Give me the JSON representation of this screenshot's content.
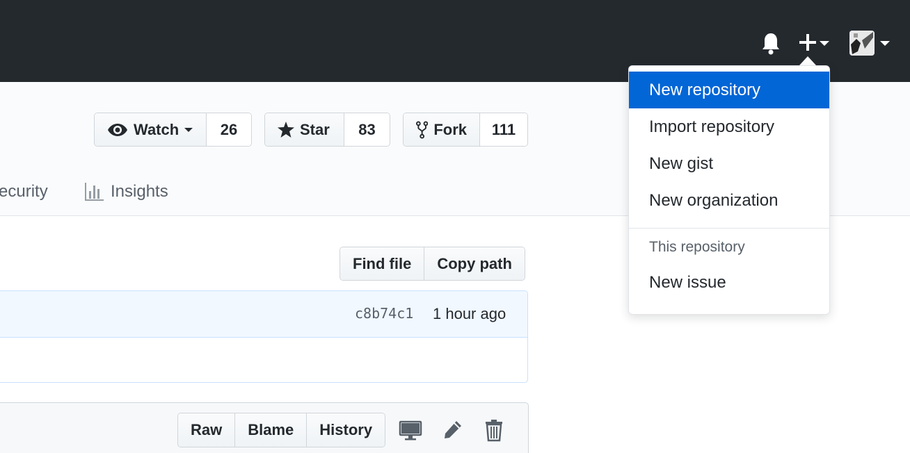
{
  "header": {
    "icons": [
      "bell-icon",
      "plus-icon",
      "avatar"
    ]
  },
  "repo_actions": {
    "watch": {
      "label": "Watch",
      "count": "26"
    },
    "star": {
      "label": "Star",
      "count": "83"
    },
    "fork": {
      "label": "Fork",
      "count": "111"
    }
  },
  "nav": {
    "security_label": "ecurity",
    "insights_label": "Insights"
  },
  "file_nav": {
    "find_file": "Find file",
    "copy_path": "Copy path"
  },
  "commit": {
    "sha": "c8b74c1",
    "time": "1 hour ago"
  },
  "file_actions": {
    "raw": "Raw",
    "blame": "Blame",
    "history": "History",
    "icons": [
      "desktop-icon",
      "pencil-icon",
      "trash-icon"
    ]
  },
  "create_menu": {
    "items": [
      {
        "label": "New repository",
        "active": true
      },
      {
        "label": "Import repository"
      },
      {
        "label": "New gist"
      },
      {
        "label": "New organization"
      }
    ],
    "section_header": "This repository",
    "section_items": [
      {
        "label": "New issue"
      }
    ],
    "highlight_color": "#0366d6"
  },
  "colors": {
    "header_bg": "#24292e",
    "repohead_bg": "#fafbfc",
    "commit_bg": "#f1f8ff"
  }
}
